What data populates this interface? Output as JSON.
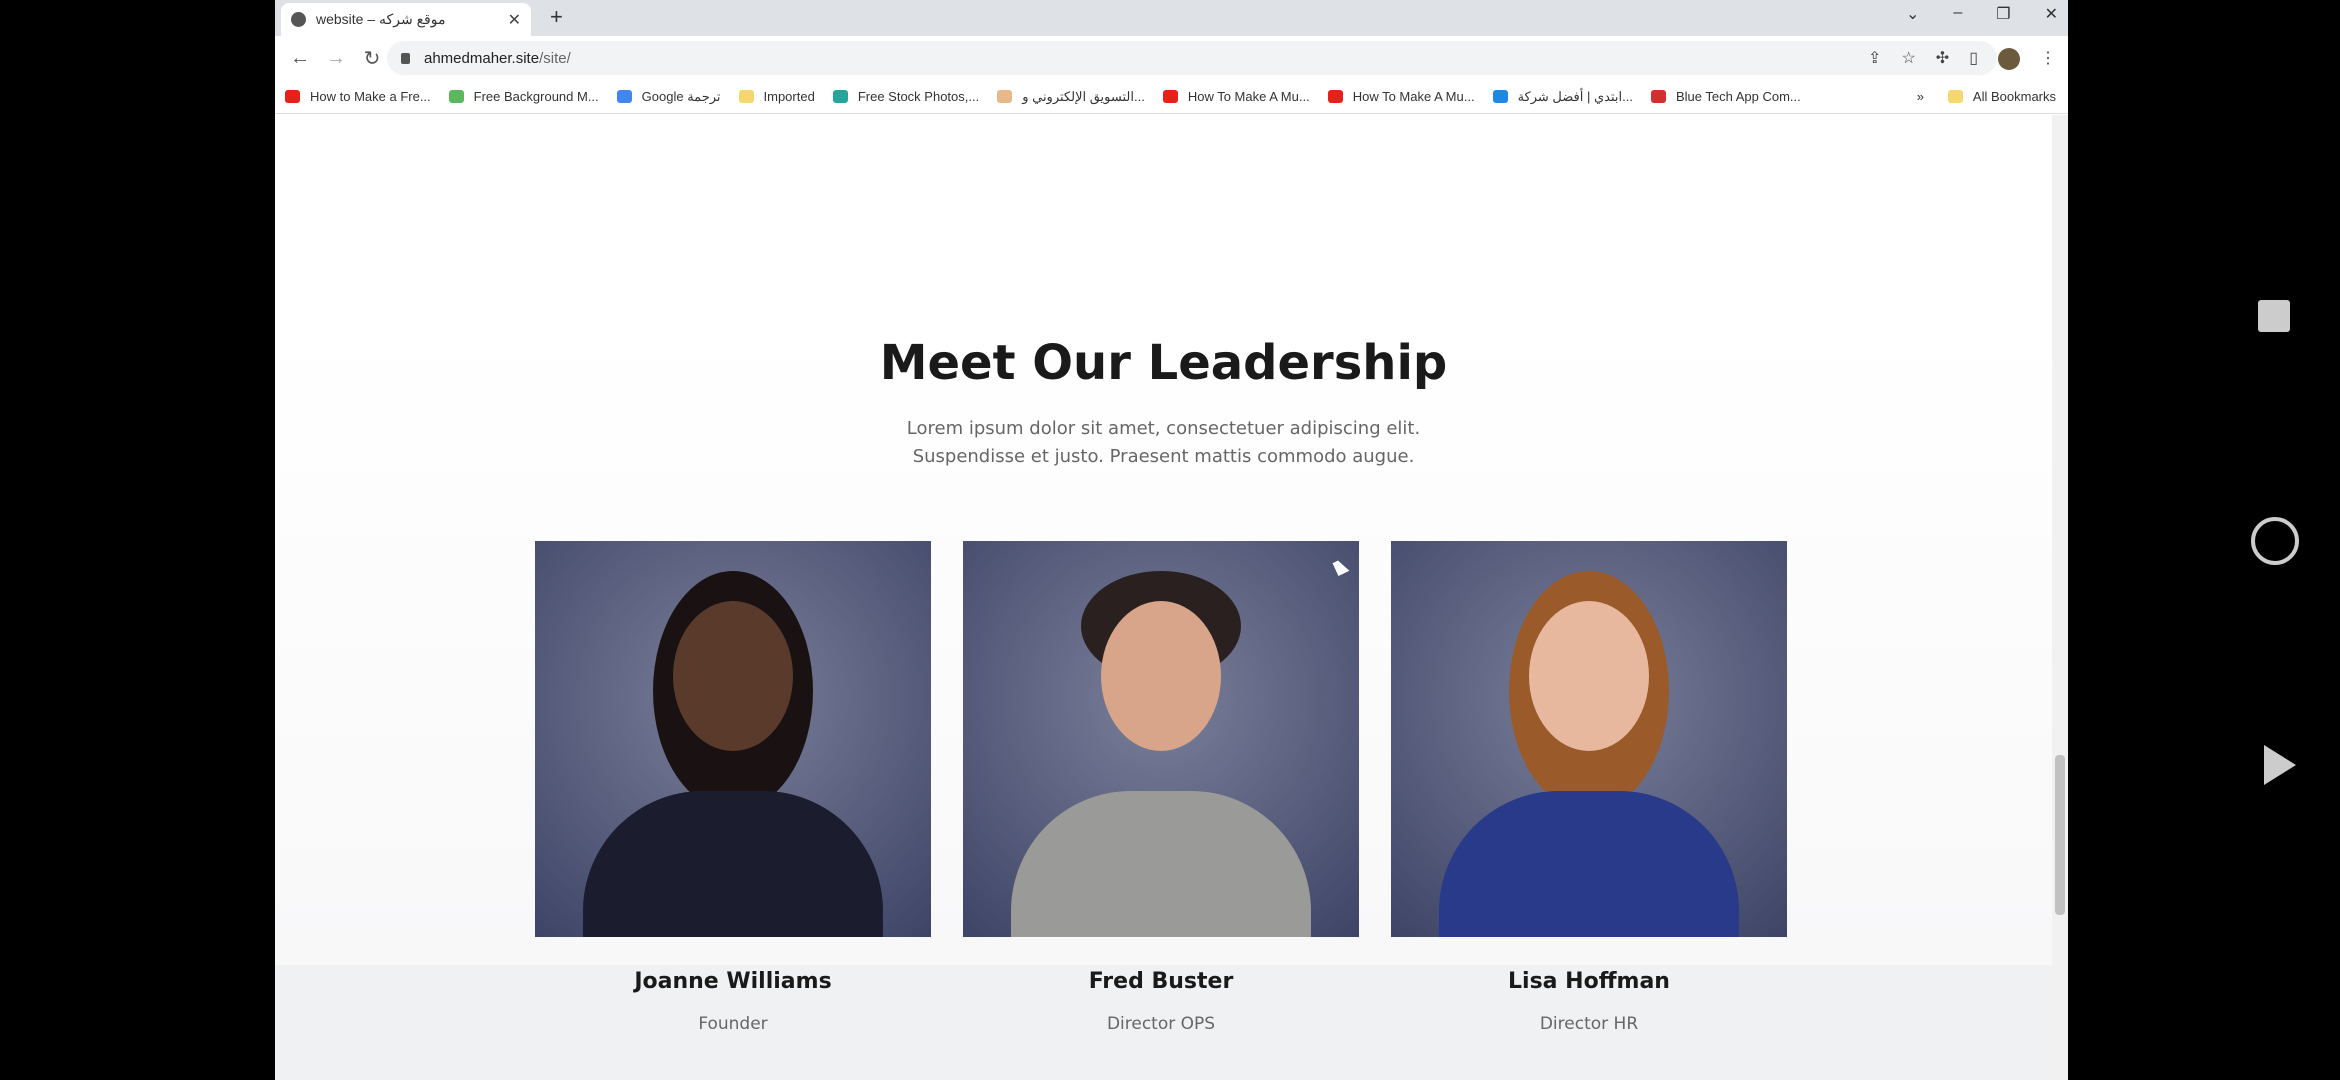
{
  "browser": {
    "tab_title": "website – موقع شركه",
    "url_host": "ahmedmaher.site",
    "url_path": "/site/",
    "bookmarks": [
      {
        "label": "How to Make a Fre...",
        "color": "#e62117"
      },
      {
        "label": "Free Background M...",
        "color": "#5cb85c"
      },
      {
        "label": "Google ترجمة",
        "color": "#4285f4"
      },
      {
        "label": "Imported",
        "color": "#f5d76e"
      },
      {
        "label": "Free Stock Photos,...",
        "color": "#26a69a"
      },
      {
        "label": "التسويق الإلكتروني و...",
        "color": "#e8b88a"
      },
      {
        "label": "How To Make A Mu...",
        "color": "#e62117"
      },
      {
        "label": "How To Make A Mu...",
        "color": "#e62117"
      },
      {
        "label": "ابتدي | أفضل شركة...",
        "color": "#1e88e5"
      },
      {
        "label": "Blue Tech App Com...",
        "color": "#d32f2f"
      }
    ],
    "more": "»",
    "all_bookmarks": "All Bookmarks"
  },
  "section": {
    "title": "Meet Our Leadership",
    "subtitle_line1": "Lorem ipsum dolor sit amet, consectetuer adipiscing elit.",
    "subtitle_line2": "Suspendisse et justo. Praesent mattis commodo augue.",
    "team": [
      {
        "name": "Joanne Williams",
        "role": "Founder"
      },
      {
        "name": "Fred Buster",
        "role": "Director OPS"
      },
      {
        "name": "Lisa Hoffman",
        "role": "Director HR"
      }
    ]
  }
}
